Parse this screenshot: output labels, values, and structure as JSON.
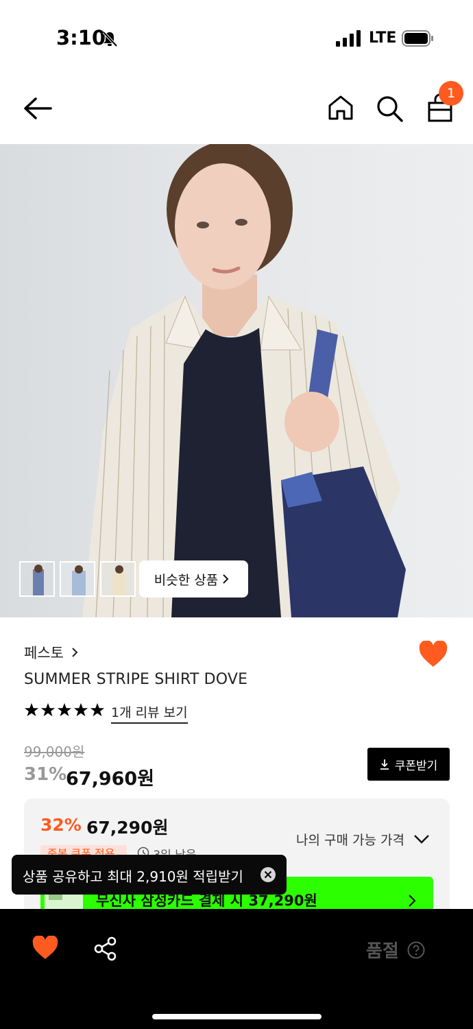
{
  "status_bar": {
    "time": "3:10",
    "network": "LTE"
  },
  "header": {
    "cart_count": "1"
  },
  "hero": {
    "similar_label": "비슷한 상품"
  },
  "product": {
    "brand": "페스토",
    "title": "SUMMER STRIPE SHIRT DOVE",
    "rating_stars": 5,
    "review_label": "1개 리뷰 보기",
    "original_price": "99,000원",
    "discount_rate": "31%",
    "price": "67,960원",
    "coupon_label": "쿠폰받기"
  },
  "best_price": {
    "discount_rate": "32%",
    "price": "67,290원",
    "label": "나의 구매 가능 가격",
    "badge": "중복 쿠폰 적용",
    "time_left": "3일 남음",
    "card_offer": "무신사 삼성카드 결제 시 37,290원"
  },
  "toast": {
    "text": "상품 공유하고 최대 2,910원 적립받기"
  },
  "bottom_bar": {
    "status": "품절"
  },
  "colors": {
    "accent": "#ff5a1f",
    "card_green": "#2bff00"
  },
  "icons": [
    "bell-off-icon",
    "signal-icon",
    "battery-icon",
    "back-arrow-icon",
    "home-icon",
    "search-icon",
    "shopping-bag-icon",
    "heart-icon",
    "star-icon",
    "download-icon",
    "chevron-down-icon",
    "chevron-right-icon",
    "close-icon",
    "share-icon",
    "help-icon"
  ]
}
